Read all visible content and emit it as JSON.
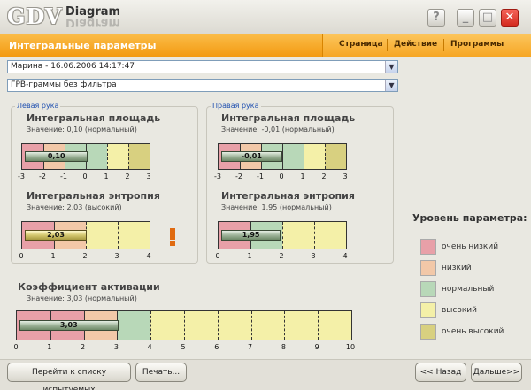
{
  "window": {
    "logo_main": "GDV",
    "logo_sub": "Diagram"
  },
  "header": {
    "title": "Интегральные параметры",
    "menu": [
      "Страница",
      "Действие",
      "Программы"
    ]
  },
  "selects": {
    "subject": "Марина - 16.06.2006 14:17:47",
    "filter": "ГРВ-граммы без фильтра"
  },
  "left_hand": {
    "legend": "Левая рука",
    "area": {
      "title": "Интегральная площадь",
      "value_text": "Значение: 0,10 (нормальный)",
      "bar_label": "0,10",
      "value": 0.1,
      "ticks": [
        "-3",
        "-2",
        "-1",
        "0",
        "1",
        "2",
        "3"
      ]
    },
    "entropy": {
      "title": "Интегральная энтропия",
      "value_text": "Значение: 2,03 (высокий)",
      "bar_label": "2,03",
      "value": 2.03,
      "ticks": [
        "0",
        "1",
        "2",
        "3",
        "4"
      ]
    }
  },
  "right_hand": {
    "legend": "Правая рука",
    "area": {
      "title": "Интегральная площадь",
      "value_text": "Значение: -0,01 (нормальный)",
      "bar_label": "-0,01",
      "value": -0.01,
      "ticks": [
        "-3",
        "-2",
        "-1",
        "0",
        "1",
        "2",
        "3"
      ]
    },
    "entropy": {
      "title": "Интегральная энтропия",
      "value_text": "Значение: 1,95 (нормальный)",
      "bar_label": "1,95",
      "value": 1.95,
      "ticks": [
        "0",
        "1",
        "2",
        "3",
        "4"
      ]
    }
  },
  "activation": {
    "title": "Коэффициент активации",
    "value_text": "Значение: 3,03 (нормальный)",
    "bar_label": "3,03",
    "value": 3.03,
    "ticks": [
      "0",
      "1",
      "2",
      "3",
      "4",
      "5",
      "6",
      "7",
      "8",
      "9",
      "10"
    ]
  },
  "legend": {
    "title": "Уровень параметра:",
    "items": [
      {
        "label": "очень низкий",
        "color": "#e8a0a8"
      },
      {
        "label": "низкий",
        "color": "#f2c8a8"
      },
      {
        "label": "нормальный",
        "color": "#b8d8b8"
      },
      {
        "label": "высокий",
        "color": "#f4f0a8"
      },
      {
        "label": "очень высокий",
        "color": "#d8d080"
      }
    ]
  },
  "buttons": {
    "subjects_list": "Перейти к списку испытуемых",
    "print": "Печать...",
    "back": "<< Назад",
    "next": "Дальше>>"
  }
}
